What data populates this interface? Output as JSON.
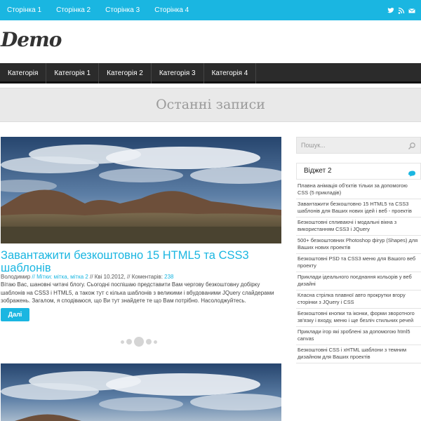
{
  "topnav": {
    "items": [
      "Сторінка 1",
      "Сторінка 2",
      "Сторінка 3",
      "Сторінка 4"
    ]
  },
  "social": {
    "icons": [
      "twitter-icon",
      "rss-icon",
      "email-icon"
    ]
  },
  "logo": "Demo",
  "catnav": {
    "items": [
      "Категорія",
      "Категорія 1",
      "Категорія 2",
      "Категорія 3",
      "Категорія 4"
    ]
  },
  "page_heading": "Останні записи",
  "post": {
    "title": "Завантажити безкоштовно 15 HTML5 та CSS3 шаблонів",
    "author": "Володимир",
    "sep1": " // ",
    "tags_label": "Мітки: ",
    "tags": "мітка, мітка 2",
    "sep2": " // ",
    "date": "Кві 10.2012,",
    "sep3": " // ",
    "comments_label": "Коментарів: ",
    "comments": "238",
    "excerpt": "Вітаю Вас, шановні читачі блогу. Сьогодні поспішаю представити Вам чергову безкоштовну добірку шаблонів на CSS3 і HTML5, а також тут с кілька шаблонів з великими і вбудованими JQuery слайдерами зображень. Загалом, я сподіваюся, що Ви тут знайдете те що Вам потрібно. Насолоджуйтесь.",
    "more_label": "Далі"
  },
  "sidebar": {
    "search_placeholder": "Пошук...",
    "widget_title": "Віджет 2",
    "links": [
      "Плавна анімація об'єктів тільки за допомогою CSS (5 прикладів)",
      "Завантажити безкоштовно 15 HTML5 та CSS3 шаблонів для Ваших нових ідей і веб - проектів",
      "Безкоштовні спливаючі і модальні вікна з використанням CSS3 і JQuery",
      "500+ безкоштовних Photoshop фігур (Shapes) для Ваших нових проектів",
      "Безкоштовні PSD та CSS3 меню для Вашого веб проекту",
      "Приклади ідеального поєднання кольорів у веб дизайні",
      "Класна стрілка плавної авто прокрутки вгору сторінки з JQuery і CSS",
      "Безкоштовні кнопки та іконки, форми зворотного зв'язку і входу, меню і ще безліч стильних речей",
      "Приклади ігор які зроблені за допомогою html5 canvas",
      "Безкоштовні CSS і xHTML шаблони з темним дизайном для Ваших проектів"
    ]
  },
  "colors": {
    "accent": "#1ab6e1",
    "nav_bg": "#2b2b2b",
    "heading_band": "#e9e9e9"
  }
}
